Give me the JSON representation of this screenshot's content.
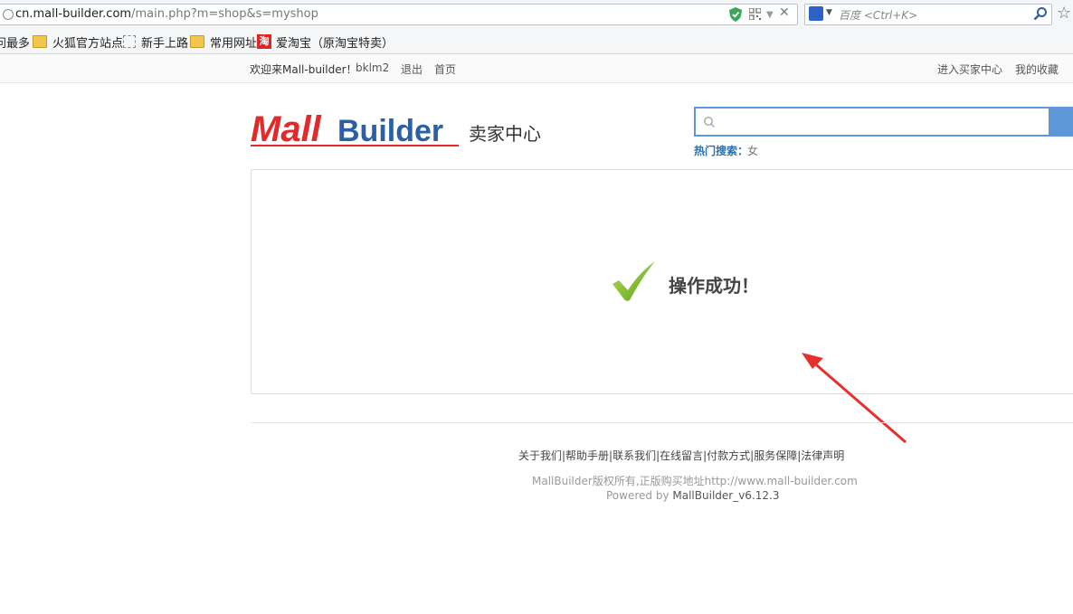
{
  "browser": {
    "url_host": "cn.mall-builder.com",
    "url_path": "/main.php?m=shop&s=myshop",
    "search_placeholder": "百度 <Ctrl+K>",
    "bookmarks": [
      {
        "label": "问最多",
        "icon": "none"
      },
      {
        "label": "火狐官方站点",
        "icon": "folder-icon"
      },
      {
        "label": "新手上路",
        "icon": "dotted-page-icon"
      },
      {
        "label": "常用网址",
        "icon": "folder-icon"
      },
      {
        "label": "爱淘宝（原淘宝特卖）",
        "icon": "taobao-icon"
      }
    ]
  },
  "topbar": {
    "welcome": "欢迎来Mall-builder！",
    "username": "bklm2",
    "logout": "退出",
    "home": "首页",
    "buyer_center": "进入买家中心",
    "favorites": "我的收藏"
  },
  "header": {
    "logo_text_1": "Mall",
    "logo_text_2": "Builder",
    "seller_center": "卖家中心",
    "hot_search_label": "热门搜索：",
    "hot_search_item": "女",
    "accent_color": "#5d97d8",
    "logo_red": "#e32a2a",
    "logo_blue": "#2b5fa8"
  },
  "message": {
    "text": "操作成功！",
    "icon": "check-icon"
  },
  "footer": {
    "links": "关于我们|帮助手册|联系我们|在线留言|付款方式|服务保障|法律声明",
    "copyright": "MallBuilder版权所有,正版购买地址http://www.mall-builder.com",
    "powered_by": "Powered by",
    "version": "MallBuilder_v6.12.3"
  }
}
